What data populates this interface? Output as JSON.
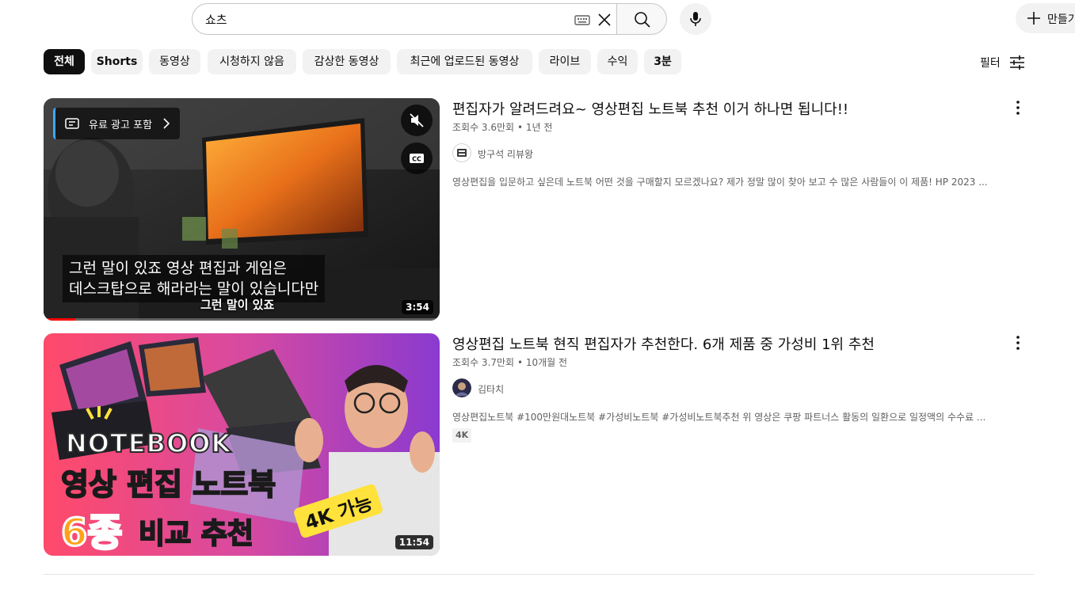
{
  "search": {
    "query": "쇼츠"
  },
  "header": {
    "create_label": "만들기"
  },
  "chips": [
    {
      "label": "전체",
      "active": true
    },
    {
      "label": "Shorts",
      "active": false
    },
    {
      "label": "동영상",
      "active": false
    },
    {
      "label": "시청하지 않음",
      "active": false
    },
    {
      "label": "감상한 동영상",
      "active": false
    },
    {
      "label": "최근에 업로드된 동영상",
      "active": false
    },
    {
      "label": "라이브",
      "active": false
    },
    {
      "label": "수익",
      "active": false
    },
    {
      "label": "3분",
      "active": false
    }
  ],
  "filter_label": "필터",
  "results": [
    {
      "title": "편집자가 알려드려요~ 영상편집 노트북 추천 이거 하나면 됩니다!!",
      "views": "조회수 3.6만회",
      "age": "1년 전",
      "channel": "방구석 리뷰왕",
      "description": "영상편집을 입문하고 싶은데 노트북 어떤 것을 구매할지 모르겠나요? 제가 정말 많이 찾아 보고 수 많은 사람들이 이 제품! HP 2023 ...",
      "duration": "3:54",
      "ad_label": "유료 광고 포함",
      "caption_line1": "그런 말이 있죠 영상 편집과 게임은",
      "caption_line2": "데스크탑으로 해라라는 말이 있습니다만",
      "burned_subtitle": "그런 말이 있죠",
      "watch_progress": 0.08
    },
    {
      "title": "영상편집 노트북 현직 편집자가 추천한다. 6개 제품 중 가성비 1위 추천",
      "views": "조회수 3.7만회",
      "age": "10개월 전",
      "channel": "김타치",
      "description": "영상편집노트북 #100만원대노트북 #가성비노트북 #가성비노트북추천 위 영상은 쿠팡 파트너스 활동의 일환으로 일정액의 수수료 ...",
      "badge": "4K",
      "duration": "11:54",
      "thumb_text1": "NOTEBOOK",
      "thumb_text2": "영상 편집 노트북",
      "thumb_num": "6종",
      "thumb_text3": "비교 추천",
      "thumb_4k": "4K 가능"
    }
  ],
  "colors": {
    "active_chip": "#0f0f0f",
    "chip_bg": "#f2f2f2",
    "meta_text": "#606060",
    "ad_accent": "#3ea6ff",
    "progress": "#ff0000"
  }
}
